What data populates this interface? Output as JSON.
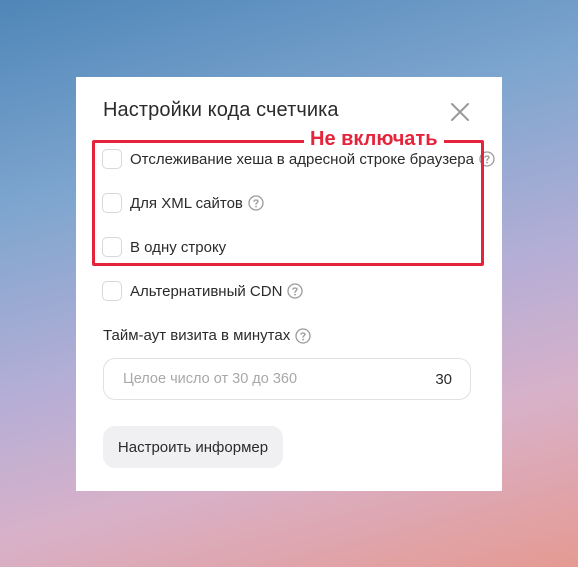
{
  "dialog": {
    "title": "Настройки кода счетчика",
    "close_icon": "close-icon"
  },
  "options": [
    {
      "label": "Отслеживание хеша в адресной строке браузера",
      "checked": false,
      "has_help": true
    },
    {
      "label": "Для XML сайтов",
      "checked": false,
      "has_help": true
    },
    {
      "label": "В одну строку",
      "checked": false,
      "has_help": false
    },
    {
      "label": "Альтернативный CDN",
      "checked": false,
      "has_help": true
    }
  ],
  "timeout": {
    "label": "Тайм-аут визита в минутах",
    "placeholder": "Целое число от 30 до 360",
    "value": "30"
  },
  "informer_button": {
    "label": "Настроить информер"
  },
  "annotation": {
    "text": "Не включать",
    "color": "#e5243b"
  }
}
